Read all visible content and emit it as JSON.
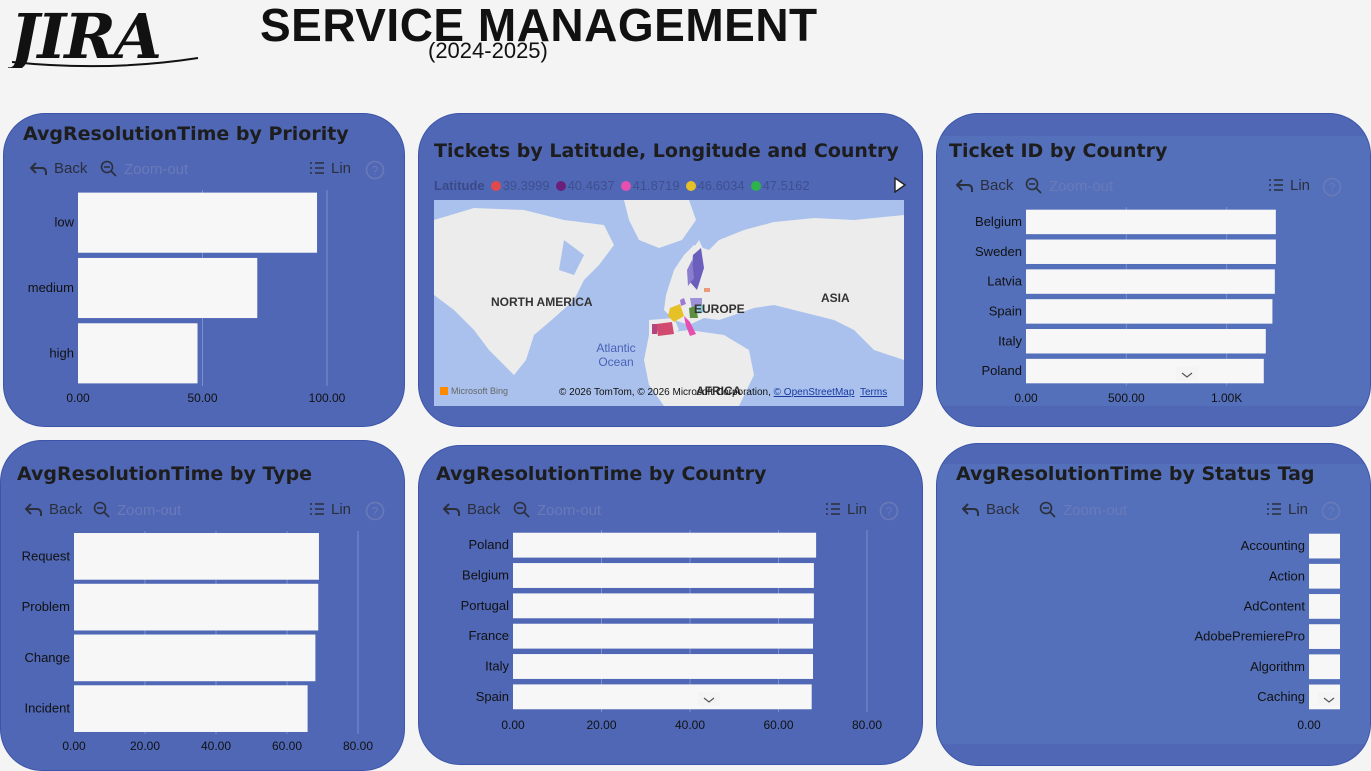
{
  "header": {
    "logo_text": "JIRA",
    "title": "SERVICE MANAGEMENT",
    "subtitle": "(2024-2025)"
  },
  "toolbar": {
    "back_label": "Back",
    "zoom_out_label": "Zoom-out",
    "lin_label": "Lin",
    "help_label": "?"
  },
  "cards": {
    "priority": {
      "title": "AvgResolutionTime by Priority",
      "chart_data": {
        "type": "bar",
        "orientation": "horizontal",
        "categories": [
          "low",
          "medium",
          "high"
        ],
        "values": [
          96,
          72,
          48
        ],
        "xlim": [
          0,
          100
        ],
        "xticks": [
          "0.00",
          "50.00",
          "100.00"
        ]
      }
    },
    "map": {
      "title": "Tickets by Latitude, Longitude and Country",
      "legend_title": "Latitude",
      "legend": [
        {
          "label": "39.3999",
          "color": "#e04a4a"
        },
        {
          "label": "40.4637",
          "color": "#6a1f7a"
        },
        {
          "label": "41.8719",
          "color": "#e64fb0"
        },
        {
          "label": "46.6034",
          "color": "#e5c027"
        },
        {
          "label": "47.5162",
          "color": "#2db34a"
        }
      ],
      "labels": {
        "north_america": "NORTH AMERICA",
        "europe": "EUROPE",
        "asia": "ASIA",
        "africa": "AFRICA",
        "ocean": "Atlantic Ocean"
      },
      "bing": "Microsoft Bing",
      "attribution": "© 2026 TomTom, © 2026 Microsoft Corporation, ",
      "osm_link": "© OpenStreetMap",
      "terms_link": "Terms"
    },
    "ticket_country": {
      "title": "Ticket ID by Country",
      "chart_data": {
        "type": "bar",
        "orientation": "horizontal",
        "categories": [
          "Belgium",
          "Sweden",
          "Latvia",
          "Spain",
          "Italy",
          "Poland"
        ],
        "values": [
          1245,
          1245,
          1240,
          1228,
          1195,
          1185
        ],
        "xlim": [
          0,
          1500
        ],
        "xticks": [
          "0.00",
          "500.00",
          "1.00K"
        ]
      }
    },
    "type": {
      "title": "AvgResolutionTime by Type",
      "chart_data": {
        "type": "bar",
        "orientation": "horizontal",
        "categories": [
          "Request",
          "Problem",
          "Change",
          "Incident"
        ],
        "values": [
          69,
          68.8,
          68,
          65.8
        ],
        "xlim": [
          0,
          80
        ],
        "xticks": [
          "0.00",
          "20.00",
          "40.00",
          "60.00",
          "80.00"
        ]
      }
    },
    "country": {
      "title": "AvgResolutionTime by Country",
      "chart_data": {
        "type": "bar",
        "orientation": "horizontal",
        "categories": [
          "Poland",
          "Belgium",
          "Portugal",
          "France",
          "Italy",
          "Spain"
        ],
        "values": [
          68.5,
          68,
          68,
          67.8,
          67.8,
          67.5
        ],
        "xlim": [
          0,
          80
        ],
        "xticks": [
          "0.00",
          "20.00",
          "40.00",
          "60.00",
          "80.00"
        ]
      }
    },
    "status": {
      "title": "AvgResolutionTime by Status Tag",
      "chart_data": {
        "type": "bar",
        "orientation": "horizontal",
        "categories": [
          "Accounting",
          "Action",
          "AdContent",
          "AdobePremierePro",
          "Algorithm",
          "Caching"
        ],
        "values": [
          1,
          1,
          1,
          1,
          1,
          1
        ],
        "xlim": [
          0,
          1
        ],
        "xticks": [
          "0.00"
        ]
      }
    }
  }
}
